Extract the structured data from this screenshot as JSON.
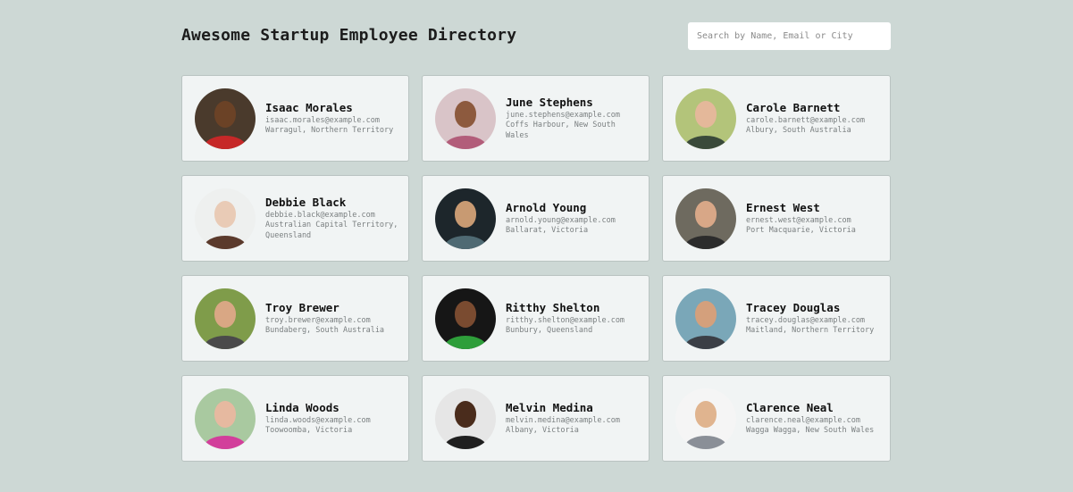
{
  "header": {
    "title": "Awesome Startup Employee Directory",
    "search_placeholder": "Search by Name, Email or City"
  },
  "employees": [
    {
      "name": "Isaac Morales",
      "email": "isaac.morales@example.com",
      "city": "Warragul, Northern Territory",
      "avatar_bg": "#4a3a2c",
      "skin": "#6b4226",
      "shirt": "#c62828"
    },
    {
      "name": "June Stephens",
      "email": "june.stephens@example.com",
      "city": "Coffs Harbour, New South Wales",
      "avatar_bg": "#d9c4c8",
      "skin": "#8d5a3e",
      "shirt": "#b25d7a"
    },
    {
      "name": "Carole Barnett",
      "email": "carole.barnett@example.com",
      "city": "Albury, South Australia",
      "avatar_bg": "#b3c47a",
      "skin": "#e4b89a",
      "shirt": "#3a4a3a"
    },
    {
      "name": "Debbie Black",
      "email": "debbie.black@example.com",
      "city": "Australian Capital Territory, Queensland",
      "avatar_bg": "#eef0ef",
      "skin": "#e9cbb6",
      "shirt": "#5b3a2c"
    },
    {
      "name": "Arnold Young",
      "email": "arnold.young@example.com",
      "city": "Ballarat, Victoria",
      "avatar_bg": "#1d262b",
      "skin": "#c89a72",
      "shirt": "#4f6a73"
    },
    {
      "name": "Ernest West",
      "email": "ernest.west@example.com",
      "city": "Port Macquarie, Victoria",
      "avatar_bg": "#6e6a5f",
      "skin": "#d8a787",
      "shirt": "#2c2c2c"
    },
    {
      "name": "Troy Brewer",
      "email": "troy.brewer@example.com",
      "city": "Bundaberg, South Australia",
      "avatar_bg": "#7f9c4a",
      "skin": "#d9a784",
      "shirt": "#4a4a4a"
    },
    {
      "name": "Ritthy Shelton",
      "email": "ritthy.shelton@example.com",
      "city": "Bunbury, Queensland",
      "avatar_bg": "#161616",
      "skin": "#7a4b30",
      "shirt": "#2e9e3a"
    },
    {
      "name": "Tracey Douglas",
      "email": "tracey.douglas@example.com",
      "city": "Maitland, Northern Territory",
      "avatar_bg": "#7aa7b8",
      "skin": "#d4a07c",
      "shirt": "#3b3f46"
    },
    {
      "name": "Linda Woods",
      "email": "linda.woods@example.com",
      "city": "Toowoomba, Victoria",
      "avatar_bg": "#a9c9a0",
      "skin": "#e6b9a0",
      "shirt": "#d23f9b"
    },
    {
      "name": "Melvin Medina",
      "email": "melvin.medina@example.com",
      "city": "Albany, Victoria",
      "avatar_bg": "#e6e6e6",
      "skin": "#4a2c1c",
      "shirt": "#1f1f1f"
    },
    {
      "name": "Clarence Neal",
      "email": "clarence.neal@example.com",
      "city": "Wagga Wagga, New South Wales",
      "avatar_bg": "#f5f5f5",
      "skin": "#e0b48f",
      "shirt": "#8a8f97"
    }
  ]
}
